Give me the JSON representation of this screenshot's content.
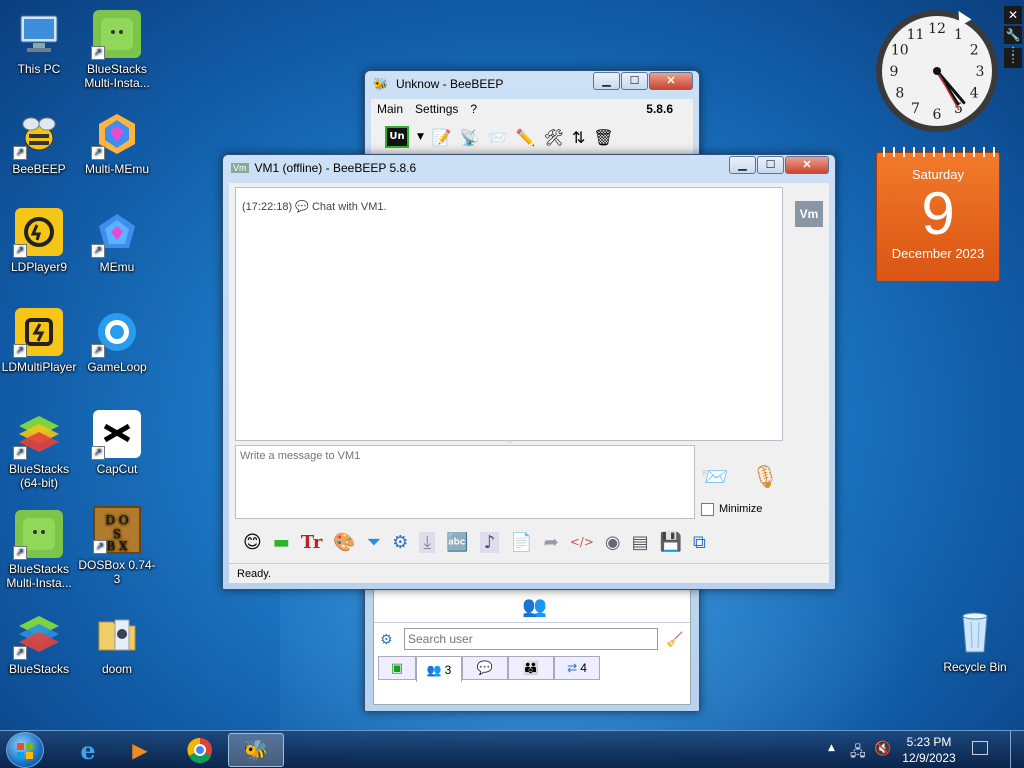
{
  "desktop": {
    "icons": [
      {
        "label": "This PC"
      },
      {
        "label": "BlueStacks Multi-Insta..."
      },
      {
        "label": "BeeBEEP"
      },
      {
        "label": "Multi-MEmu"
      },
      {
        "label": "LDPlayer9"
      },
      {
        "label": "MEmu"
      },
      {
        "label": "LDMultiPlayer"
      },
      {
        "label": "GameLoop"
      },
      {
        "label": "BlueStacks (64-bit)"
      },
      {
        "label": "CapCut"
      },
      {
        "label": "BlueStacks Multi-Insta..."
      },
      {
        "label": "DOSBox 0.74-3"
      },
      {
        "label": "BlueStacks"
      },
      {
        "label": "doom"
      },
      {
        "label": "Recycle Bin"
      }
    ]
  },
  "gadgets": {
    "calendar": {
      "weekday": "Saturday",
      "day": "9",
      "month_year": "December 2023"
    },
    "clock": {
      "numbers": [
        "12",
        "1",
        "2",
        "3",
        "4",
        "5",
        "6",
        "7",
        "8",
        "9",
        "10",
        "11"
      ],
      "time_shown": "5:23"
    }
  },
  "main_window": {
    "title": "Unknow - BeeBEEP",
    "menu": [
      "Main",
      "Settings",
      "?"
    ],
    "version": "5.8.6",
    "status_label": "Un",
    "search_placeholder": "Search user",
    "tabs": [
      {
        "icon": "status-icon",
        "count": ""
      },
      {
        "icon": "users-icon",
        "count": "3"
      },
      {
        "icon": "chat-icon",
        "count": ""
      },
      {
        "icon": "groups-icon",
        "count": ""
      },
      {
        "icon": "shares-icon",
        "count": "4"
      }
    ]
  },
  "chat_window": {
    "title": "VM1 (offline) - BeeBEEP 5.8.6",
    "message": {
      "time": "(17:22:18)",
      "text": "Chat with VM1."
    },
    "input_placeholder": "Write a message to VM1",
    "minimize_label": "Minimize",
    "avatar": "Vm",
    "status": "Ready."
  },
  "taskbar": {
    "time": "5:23 PM",
    "date": "12/9/2023"
  },
  "colors": {
    "accent": "#e8641c",
    "taskbar": "#16355f",
    "chat_bg": "#ffffff"
  }
}
